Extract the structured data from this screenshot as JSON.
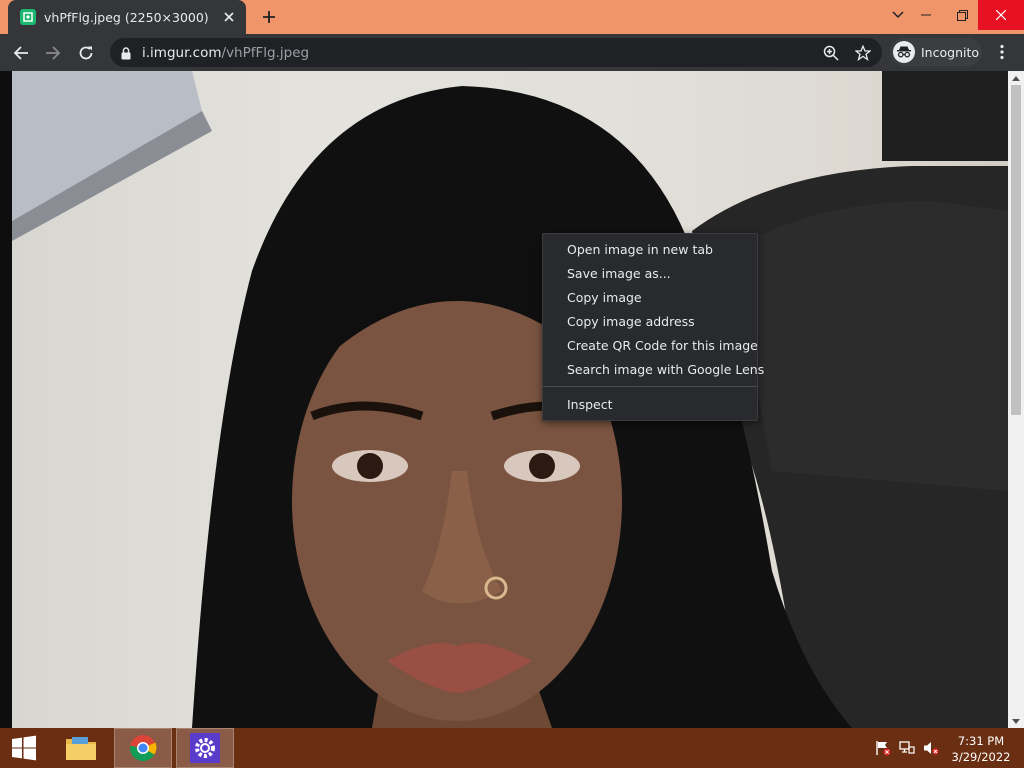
{
  "window": {
    "tab_title": "vhPfFlg.jpeg (2250×3000)",
    "close_tab_icon": "close-icon",
    "new_tab_icon": "plus-icon",
    "controls": [
      "chevron-down-icon",
      "restore-icon",
      "close-icon"
    ]
  },
  "toolbar": {
    "url_host": "i.imgur.com",
    "url_path": "/vhPfFlg.jpeg",
    "profile_label": "Incognito",
    "icons": [
      "back-arrow-icon",
      "forward-arrow-icon",
      "reload-icon",
      "lock-icon",
      "zoom-icon",
      "star-icon",
      "kebab-menu-icon"
    ]
  },
  "context_menu": {
    "items": [
      "Open image in new tab",
      "Save image as...",
      "Copy image",
      "Copy image address",
      "Create QR Code for this image",
      "Search image with Google Lens",
      "Inspect"
    ]
  },
  "taskbar": {
    "apps": [
      "start-icon",
      "file-explorer-icon",
      "chrome-icon",
      "settings-icon"
    ],
    "tray": [
      "flag-icon",
      "network-icon",
      "volume-muted-icon"
    ],
    "time": "7:31 PM",
    "date": "3/29/2022"
  },
  "colors": {
    "titlebar": "#f0956a",
    "toolbar": "#35363a",
    "menu_bg": "#292a2d",
    "taskbar": "#6a2e12"
  }
}
